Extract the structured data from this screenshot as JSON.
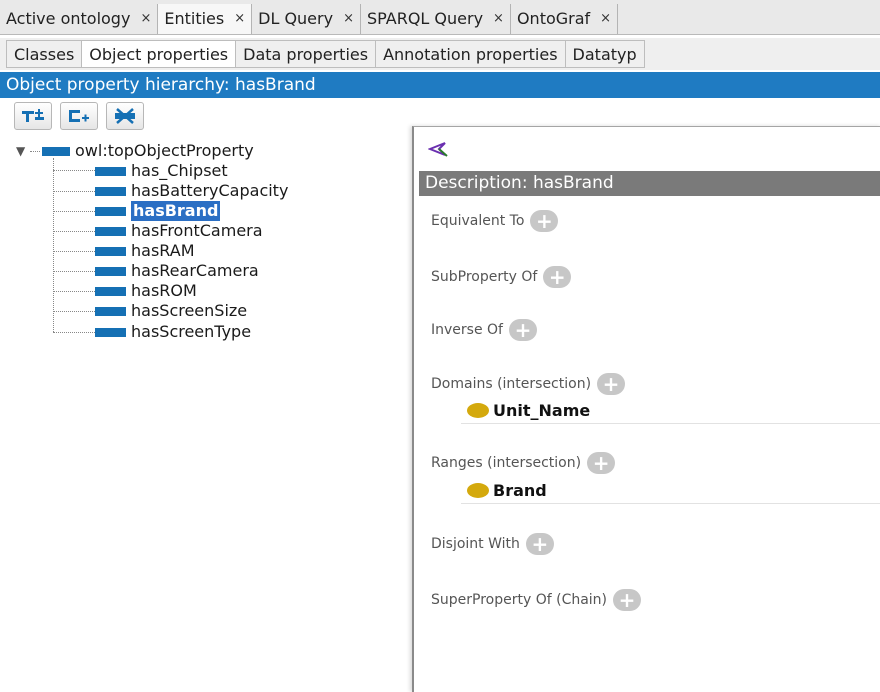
{
  "top_tabs": [
    {
      "label": "Active ontology",
      "close": "×"
    },
    {
      "label": "Entities",
      "close": "×"
    },
    {
      "label": "DL Query",
      "close": "×"
    },
    {
      "label": "SPARQL Query",
      "close": "×"
    },
    {
      "label": "OntoGraf",
      "close": "×"
    }
  ],
  "sub_tabs": [
    "Classes",
    "Object properties",
    "Data properties",
    "Annotation properties",
    "Datatyp"
  ],
  "hierarchy": {
    "title": "Object property hierarchy: hasBrand",
    "root": "owl:topObjectProperty",
    "items": [
      "has_Chipset",
      "hasBatteryCapacity",
      "hasBrand",
      "hasFrontCamera",
      "hasRAM",
      "hasRearCamera",
      "hasROM",
      "hasScreenSize",
      "hasScreenType"
    ],
    "selected": "hasBrand"
  },
  "toolbar": {
    "icons": [
      "add-subproperty-icon",
      "add-sibling-property-icon",
      "delete-property-icon"
    ]
  },
  "description": {
    "title": "Description: hasBrand",
    "sections": {
      "equivalent_to": "Equivalent To",
      "subproperty_of": "SubProperty Of",
      "inverse_of": "Inverse Of",
      "domains": "Domains (intersection)",
      "domain_value": "Unit_Name",
      "ranges": "Ranges (intersection)",
      "range_value": "Brand",
      "disjoint_with": "Disjoint With",
      "superproperty_chain": "SuperProperty Of (Chain)"
    },
    "plus": "+"
  },
  "colors": {
    "accent": "#1f7bc2",
    "property_swatch": "#1570b4",
    "class_dot": "#d4a90d",
    "panel_header": "#7a7a7a"
  }
}
